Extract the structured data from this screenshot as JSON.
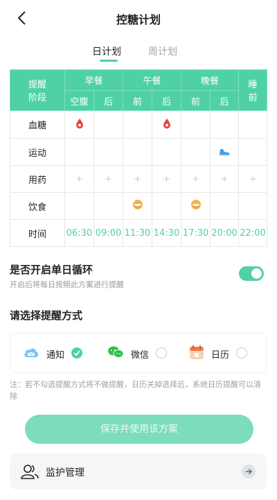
{
  "header": {
    "title": "控糖计划"
  },
  "tabs": [
    {
      "label": "日计划",
      "active": true
    },
    {
      "label": "周计划",
      "active": false
    }
  ],
  "plan_table": {
    "corner_label": [
      "提醒",
      "阶段"
    ],
    "meals": [
      {
        "label": "早餐",
        "sub": [
          "空腹",
          "后"
        ]
      },
      {
        "label": "午餐",
        "sub": [
          "前",
          "后"
        ]
      },
      {
        "label": "晚餐",
        "sub": [
          "前",
          "后"
        ]
      }
    ],
    "sleep": [
      "睡",
      "前"
    ],
    "rows": {
      "blood_sugar": "血糖",
      "exercise": "运动",
      "medicine": "用药",
      "diet": "饮食",
      "time": "时间"
    },
    "plus": "+",
    "times": [
      "06:30",
      "09:00",
      "11:30",
      "14:30",
      "17:30",
      "20:00",
      "22:00"
    ]
  },
  "daily_loop": {
    "title": "是否开启单日循环",
    "subtitle": "开启后将每日按照此方案进行提醒",
    "enabled": true
  },
  "reminder": {
    "title": "请选择提醒方式",
    "methods": [
      {
        "label": "通知",
        "selected": true
      },
      {
        "label": "微信",
        "selected": false
      },
      {
        "label": "日历",
        "selected": false
      }
    ]
  },
  "note": "注：若不勾选提醒方式将不做提醒，日历关掉选择后，系统日历提醒可以清除",
  "save_button": "保存并使用该方案",
  "monitor": {
    "label": "监护管理"
  },
  "colors": {
    "accent": "#4fd1a5",
    "drop": "#e8453c",
    "egg": "#f5b24a",
    "shoe": "#4a9ee8"
  }
}
